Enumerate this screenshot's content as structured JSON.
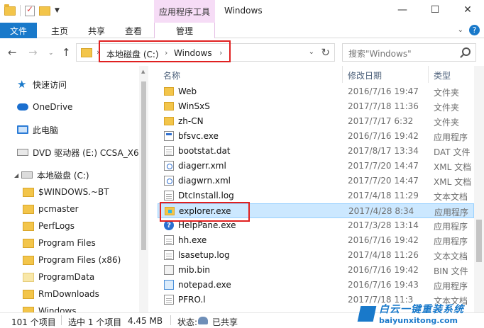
{
  "window": {
    "title": "Windows",
    "contextual_tab_group": "应用程序工具",
    "controls": {
      "minimize": "—",
      "maximize": "☐",
      "close": "✕"
    }
  },
  "ribbon": {
    "tabs": [
      "文件",
      "主页",
      "共享",
      "查看",
      "管理"
    ],
    "active_tab": "文件",
    "accent_color": "#1979ca",
    "contextual_color": "#f6dcf6"
  },
  "address": {
    "breadcrumbs": [
      "本地磁盘 (C:)",
      "Windows"
    ],
    "separator": "›",
    "search_placeholder": "搜索\"Windows\""
  },
  "nav_pane": {
    "items": [
      {
        "label": "快速访问",
        "icon": "star-icon"
      },
      {
        "label": "OneDrive",
        "icon": "cloud-icon"
      },
      {
        "label": "此电脑",
        "icon": "computer-icon"
      },
      {
        "label": "DVD 驱动器 (E:) CCSA_X64",
        "icon": "dvd-drive-icon"
      },
      {
        "label": "本地磁盘 (C:)",
        "icon": "drive-icon"
      },
      {
        "label": "$WINDOWS.~BT",
        "icon": "folder-icon"
      },
      {
        "label": "pcmaster",
        "icon": "folder-icon"
      },
      {
        "label": "PerfLogs",
        "icon": "folder-icon"
      },
      {
        "label": "Program Files",
        "icon": "folder-icon"
      },
      {
        "label": "Program Files (x86)",
        "icon": "folder-icon"
      },
      {
        "label": "ProgramData",
        "icon": "folder-icon"
      },
      {
        "label": "RmDownloads",
        "icon": "folder-icon"
      },
      {
        "label": "Windows",
        "icon": "folder-icon"
      }
    ]
  },
  "file_list": {
    "columns": {
      "name": "名称",
      "date": "修改日期",
      "type": "类型"
    },
    "rows": [
      {
        "name": "Web",
        "date": "2016/7/16 19:47",
        "type": "文件夹",
        "icon": "folder-icon"
      },
      {
        "name": "WinSxS",
        "date": "2017/7/18 11:36",
        "type": "文件夹",
        "icon": "folder-icon"
      },
      {
        "name": "zh-CN",
        "date": "2017/7/17 6:32",
        "type": "文件夹",
        "icon": "folder-icon"
      },
      {
        "name": "bfsvc.exe",
        "date": "2016/7/16 19:42",
        "type": "应用程序",
        "icon": "application-icon"
      },
      {
        "name": "bootstat.dat",
        "date": "2017/8/17 13:34",
        "type": "DAT 文件",
        "icon": "document-icon"
      },
      {
        "name": "diagerr.xml",
        "date": "2017/7/20 14:47",
        "type": "XML 文档",
        "icon": "xml-document-icon"
      },
      {
        "name": "diagwrn.xml",
        "date": "2017/7/20 14:47",
        "type": "XML 文档",
        "icon": "xml-document-icon"
      },
      {
        "name": "DtcInstall.log",
        "date": "2017/4/18 11:29",
        "type": "文本文档",
        "icon": "document-icon"
      },
      {
        "name": "explorer.exe",
        "date": "2017/4/28 8:34",
        "type": "应用程序",
        "icon": "explorer-icon",
        "selected": true
      },
      {
        "name": "HelpPane.exe",
        "date": "2017/3/28 13:14",
        "type": "应用程序",
        "icon": "help-icon"
      },
      {
        "name": "hh.exe",
        "date": "2016/7/16 19:42",
        "type": "应用程序",
        "icon": "document-icon"
      },
      {
        "name": "lsasetup.log",
        "date": "2017/4/18 11:26",
        "type": "文本文档",
        "icon": "document-icon"
      },
      {
        "name": "mib.bin",
        "date": "2016/7/16 19:42",
        "type": "BIN 文件",
        "icon": "binary-file-icon"
      },
      {
        "name": "notepad.exe",
        "date": "2016/7/16 19:43",
        "type": "应用程序",
        "icon": "notepad-icon"
      },
      {
        "name": "PFRO.l",
        "date": "2017/7/18 11:3",
        "type": "文本文档",
        "icon": "document-icon"
      }
    ]
  },
  "status_bar": {
    "item_count": "101 个项目",
    "selected": "选中 1 个项目",
    "size": "4.45 MB",
    "state_label": "状态:",
    "share_status": "已共享"
  },
  "watermark": {
    "title": "白云一键重装系统",
    "url": "baiyunxitong.com"
  }
}
